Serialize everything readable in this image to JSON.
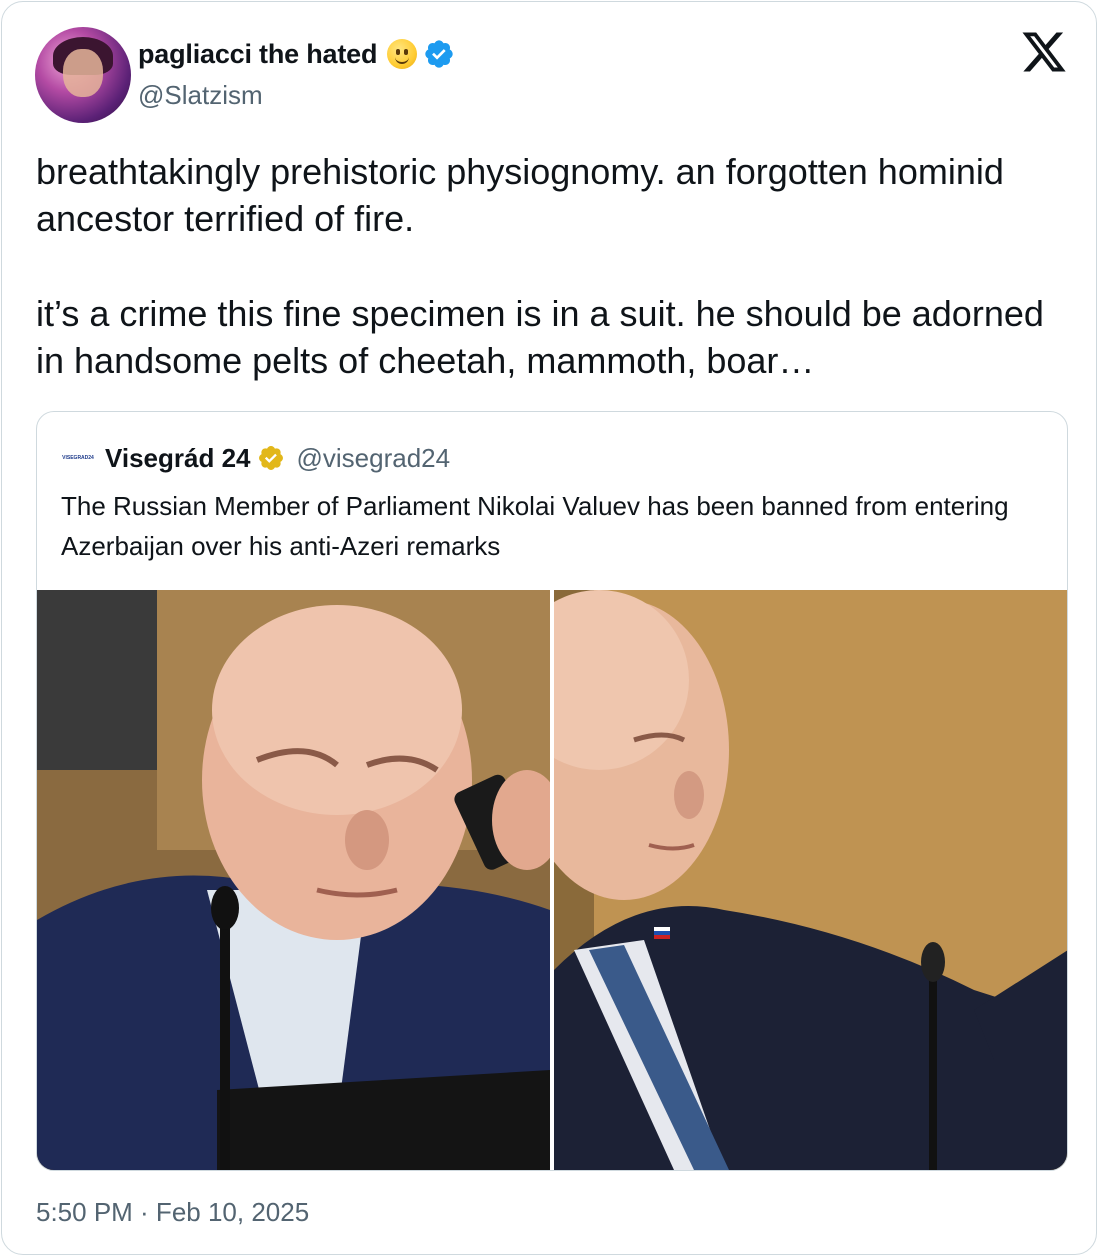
{
  "author": {
    "name": "pagliacci the hated",
    "handle": "@Slatzism",
    "emoji": "slightly-smiling-face-emoji",
    "verified_icon": "verified-badge-icon"
  },
  "platform_icon": "x-logo-icon",
  "tweet": {
    "paragraphs": [
      "breathtakingly prehistoric physiognomy. an forgotten hominid ancestor terrified of fire.",
      "it’s a crime this fine specimen is in a suit. he should be adorned in handsome pelts of cheetah, mammoth, boar…"
    ],
    "timestamp": "5:50 PM · Feb 10, 2025"
  },
  "quoted_tweet": {
    "logo_text": "VISEGRAD24",
    "name": "Visegrád 24",
    "handle": "@visegrad24",
    "badge_icon": "gold-verified-badge-icon",
    "text": "The Russian Member of Parliament Nikolai Valuev has been banned from entering Azerbaijan over his anti-Azeri remarks",
    "images": [
      {
        "description_name": "photo-left"
      },
      {
        "description_name": "photo-right"
      }
    ]
  },
  "colors": {
    "text_primary": "#0f1419",
    "text_secondary": "#536471",
    "border": "#cfd9de",
    "verified_blue": "#1d9bf0",
    "verified_gold": "#e2b719"
  }
}
